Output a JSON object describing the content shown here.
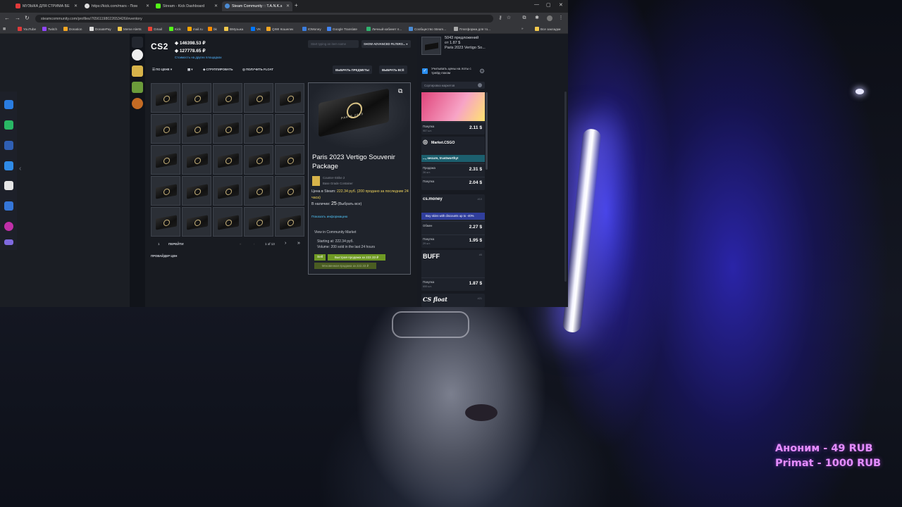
{
  "browser": {
    "tabs": [
      {
        "title": "МУЗЫКА ДЛЯ СТРИМА БЕ",
        "active": false
      },
      {
        "title": "https://kick.com/mars - Пом",
        "active": false
      },
      {
        "title": "Stream - Kick Dashboard",
        "active": false
      },
      {
        "title": "Steam Community :: T.A.N.K.s",
        "active": true
      }
    ],
    "url": "steamcommunity.com/profiles/76561198022653426/inventory",
    "bookmarks": [
      "YouTube",
      "Twitch",
      "Donation",
      "DonatePay",
      "Meme Alerts",
      "Gmail",
      "Kick",
      "mail.ru",
      "bk",
      "ВМузыка",
      "VK",
      "QIWI Кошелек",
      "IOMoney",
      "Google Translate",
      "Личный кабинет п...",
      "Сообщество Steam...",
      "Платформа для то..."
    ],
    "all_bookmarks": "Все закладки"
  },
  "inventory": {
    "game": "CS2",
    "balance_primary": "146398.53 ₽",
    "balance_secondary": "127778.65 ₽",
    "balance_link": "Стоимость на других площадках",
    "search_placeholder": "Start typing an item name",
    "advanced_filters": "SHOW ADVANCED FILTERS...",
    "toolbar": {
      "sort": "ПО ЦЕНЕ",
      "group": "СГРУППИРОВАТЬ",
      "float": "ПОЛУЧИТЬ FLOAT",
      "select_items": "ВЫБРАТЬ ПРЕДМЕТЫ",
      "select_all": "ВЫБРАТЬ ВСЁ"
    },
    "pager": {
      "page": "1",
      "go": "ПЕРЕЙТИ",
      "of": "1 of 13"
    },
    "provider": "ПРОВАЙДЕР ЦЕН"
  },
  "item": {
    "name": "Paris 2023 Vertigo Souvenir Package",
    "game": "Counter-Strike 2",
    "type": "Base Grade Container",
    "steam_price_label": "Цена в Steam:",
    "steam_price": "222.34 руб. (200 продано за последние 24 часа)",
    "stock_label": "В наличии:",
    "stock": "25",
    "select_all": "(Выбрать все)",
    "show_info": "Показать информацию",
    "market_link": "View in Community Market",
    "starting_at": "Starting at: 222.34 руб.",
    "volume": "Volume: 200 sold in the last 24 hours",
    "sell": "Sell",
    "quick_sell": "Быстрая продажа за 222.33 ₽",
    "instant_sell": "Мгновенная продажа за 222.33 ₽",
    "package_text": "PARIS 2023"
  },
  "extension": {
    "offers": "5043 предложений",
    "from": "от 1.87 $",
    "item": "Paris 2023 Vertigo So...",
    "trade_lock": "Учитывать цены на лоты с трейд-локом",
    "sort_markets": "Сортировка маркетов",
    "markets": [
      {
        "name": "",
        "rows": [
          {
            "label": "Покупка",
            "sub": "957 шт.",
            "value": "2.11 $"
          }
        ]
      },
      {
        "name": "Market.CSGO",
        "banner": "..., secure, trustworthy!",
        "rows": [
          {
            "label": "Продажа",
            "sub": "26 шт.",
            "value": "2.31 $"
          },
          {
            "label": "Покупка",
            "sub": "",
            "value": "2.04 $"
          }
        ]
      },
      {
        "name": "cs.money",
        "banner": "Buy skins with discounts up to -40%",
        "rows": [
          {
            "label": "Обмен",
            "sub": "",
            "value": "2.27 $"
          },
          {
            "label": "Покупка",
            "sub": "29 шт.",
            "value": "1.95 $"
          }
        ]
      },
      {
        "name": "BUFF",
        "rows": [
          {
            "label": "Покупка",
            "sub": "655 шт.",
            "value": "1.87 $"
          }
        ]
      },
      {
        "name": "CS float",
        "rows": []
      }
    ]
  },
  "donations": [
    {
      "text": "Аноним - 49 RUB"
    },
    {
      "text": "Primat - 1000 RUB"
    }
  ],
  "colors": {
    "accent_green": "#6f9a24",
    "link_blue": "#4fb3ff",
    "donation": "#e58cff"
  }
}
